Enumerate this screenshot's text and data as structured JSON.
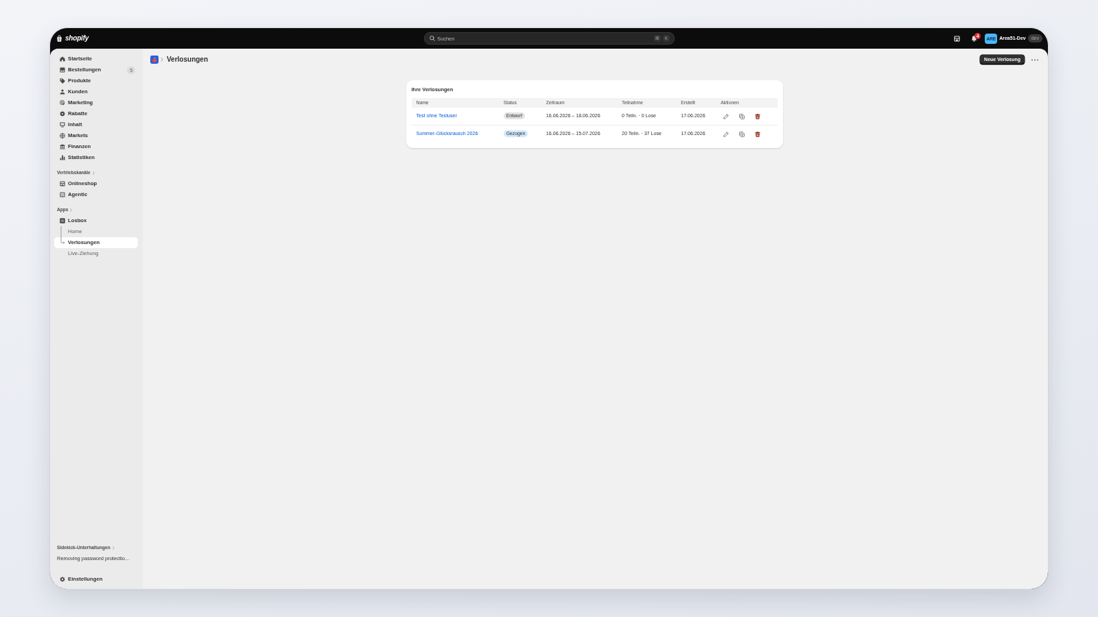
{
  "topbar": {
    "logo": "shopify",
    "search": {
      "placeholder": "Suchen",
      "shortcut_keys": [
        "⌘",
        "K"
      ]
    },
    "notification_count": "4",
    "account": {
      "initials": "ARE",
      "name": "Area51-Dev",
      "environment": "dev"
    }
  },
  "sidebar": {
    "items": [
      {
        "label": "Startseite",
        "selected": false
      },
      {
        "label": "Bestellungen",
        "badge": "5",
        "selected": false
      },
      {
        "label": "Produkte",
        "selected": false
      },
      {
        "label": "Kunden",
        "selected": false
      },
      {
        "label": "Marketing",
        "selected": false
      },
      {
        "label": "Rabatte",
        "selected": false
      },
      {
        "label": "Inhalt",
        "selected": false
      },
      {
        "label": "Markets",
        "selected": false
      },
      {
        "label": "Finanzen",
        "selected": false
      },
      {
        "label": "Statistiken",
        "selected": false
      }
    ],
    "sections": [
      {
        "title": "Vertriebskanäle",
        "items": [
          {
            "label": "Onlineshop",
            "selected": false
          },
          {
            "label": "Agentic",
            "selected": false
          }
        ]
      },
      {
        "title": "Apps",
        "items": [
          {
            "label": "Losbox",
            "selected": false,
            "children": [
              {
                "label": "Home",
                "selected": false
              },
              {
                "label": "Verlosungen",
                "selected": true
              },
              {
                "label": "Live-Ziehung",
                "selected": false
              }
            ]
          }
        ]
      }
    ],
    "sidekick": {
      "title": "Sidekick-Unterhaltungen",
      "conversations": [
        "Removing password protectio…"
      ]
    },
    "settings": {
      "label": "Einstellungen",
      "selected": false
    }
  },
  "page": {
    "title": "Verlosungen",
    "primary_action": "Neue Verlosung"
  },
  "card": {
    "title": "Ihre Verlosungen",
    "columns": [
      "Name",
      "Status",
      "Zeitraum",
      "Teilnahme",
      "Erstellt",
      "Aktionen"
    ],
    "rows": [
      {
        "name": "Test ohne Testuser",
        "status": {
          "label": "Entwurf",
          "color": "#e3e3e3"
        },
        "period": "16.06.2026 – 18.06.2026",
        "participation": "0 Teiln. · 0 Lose",
        "created": "17.06.2026"
      },
      {
        "name": "Sommer-Glücksrausch 2026",
        "status": {
          "label": "Gezogen",
          "color": "#d1e8fd"
        },
        "period": "16.06.2026 – 15.07.2026",
        "participation": "20 Teiln. · 37 Lose",
        "created": "17.06.2026"
      }
    ]
  }
}
